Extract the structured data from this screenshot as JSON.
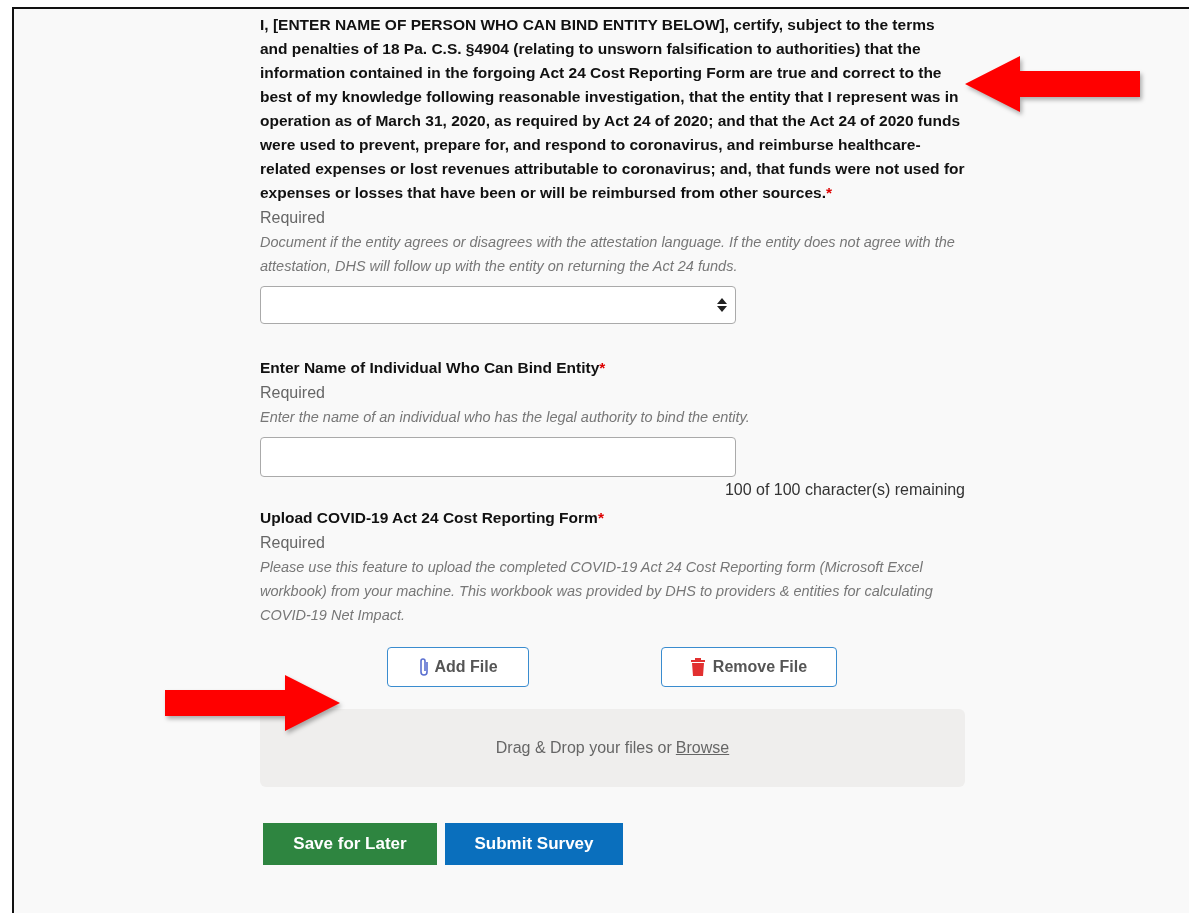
{
  "questions": [
    {
      "kind": "select",
      "label": "I, [ENTER NAME OF PERSON WHO CAN BIND ENTITY BELOW], certify, subject to the terms and penalties of 18 Pa. C.S.  §4904 (relating to unsworn falsification to authorities) that the information contained in the forgoing Act 24 Cost Reporting Form are true and correct to the best of my knowledge following reasonable investigation, that the entity that I represent was in operation as of March 31, 2020, as required by Act 24 of 2020; and that the Act 24 of 2020 funds were used to prevent, prepare for, and respond to coronavirus, and reimburse healthcare-related expenses or lost revenues attributable to coronavirus; and, that funds were not used for expenses or losses that have been or will be reimbursed from other sources.",
      "required_mark": "*",
      "required_text": "Required",
      "help": "Document if the entity agrees or disagrees with the attestation language. If the entity does not agree with the attestation, DHS will follow up with the entity on returning the Act 24 funds."
    },
    {
      "kind": "text",
      "label": "Enter Name of Individual Who Can Bind Entity",
      "required_mark": "*",
      "required_text": "Required",
      "help": "Enter the name of an individual who has the legal authority to bind the entity.",
      "counter": "100 of 100 character(s) remaining"
    },
    {
      "kind": "upload",
      "label": "Upload COVID-19 Act 24 Cost Reporting Form",
      "required_mark": "*",
      "required_text": "Required",
      "help": "Please use this feature to upload the completed COVID-19 Act 24 Cost Reporting form (Microsoft Excel workbook) from your machine. This workbook was provided by DHS to providers & entities for calculating COVID-19 Net Impact.",
      "add_button": "Add File",
      "remove_button": "Remove File",
      "drop_text": "Drag & Drop your files or",
      "drop_link": "Browse"
    }
  ],
  "actions": [
    {
      "label": "Save for Later",
      "kind": "secondary"
    },
    {
      "label": "Submit Survey",
      "kind": "primary"
    }
  ]
}
